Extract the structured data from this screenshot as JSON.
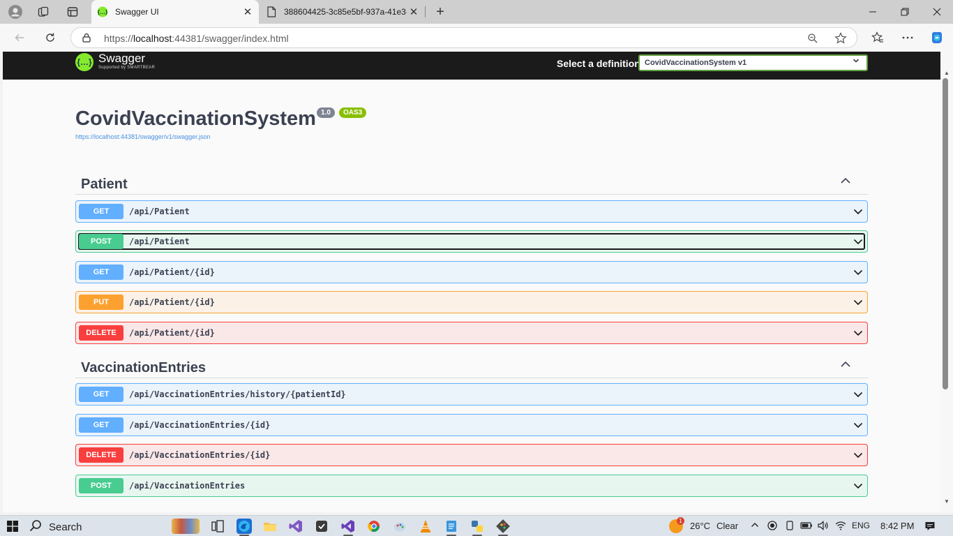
{
  "browser": {
    "tabs": [
      {
        "title": "Swagger UI",
        "active": true
      },
      {
        "title": "388604425-3c85e5bf-937a-41e3-",
        "active": false
      }
    ],
    "url_prefix": "https://",
    "url_host": "localhost",
    "url_rest": ":44381/swagger/index.html"
  },
  "swagger": {
    "logo_text": "Swagger",
    "logo_subtext": "Supported by SMARTBEAR",
    "definition_label": "Select a definition",
    "definition_selected": "CovidVaccinationSystem v1",
    "api_title": "CovidVaccinationSystem",
    "version_badge": "1.0",
    "oas_badge": "OAS3",
    "spec_url": "https://localhost:44381/swagger/v1/swagger.json",
    "tags": [
      {
        "name": "Patient",
        "expanded": true,
        "operations": [
          {
            "method": "GET",
            "path": "/api/Patient"
          },
          {
            "method": "POST",
            "path": "/api/Patient",
            "focused": true
          },
          {
            "method": "GET",
            "path": "/api/Patient/{id}"
          },
          {
            "method": "PUT",
            "path": "/api/Patient/{id}"
          },
          {
            "method": "DELETE",
            "path": "/api/Patient/{id}"
          }
        ]
      },
      {
        "name": "VaccinationEntries",
        "expanded": true,
        "operations": [
          {
            "method": "GET",
            "path": "/api/VaccinationEntries/history/{patientId}"
          },
          {
            "method": "GET",
            "path": "/api/VaccinationEntries/{id}"
          },
          {
            "method": "DELETE",
            "path": "/api/VaccinationEntries/{id}"
          },
          {
            "method": "POST",
            "path": "/api/VaccinationEntries"
          }
        ]
      }
    ]
  },
  "colors": {
    "get": "#61affe",
    "post": "#49cc90",
    "put": "#fca130",
    "delete": "#f93e3e",
    "swagger_green": "#85ea2d"
  },
  "taskbar": {
    "search_label": "Search",
    "weather_badge": "1",
    "weather": "26°C",
    "weather_desc": "Clear",
    "language": "ENG",
    "time": "8:42 PM"
  }
}
